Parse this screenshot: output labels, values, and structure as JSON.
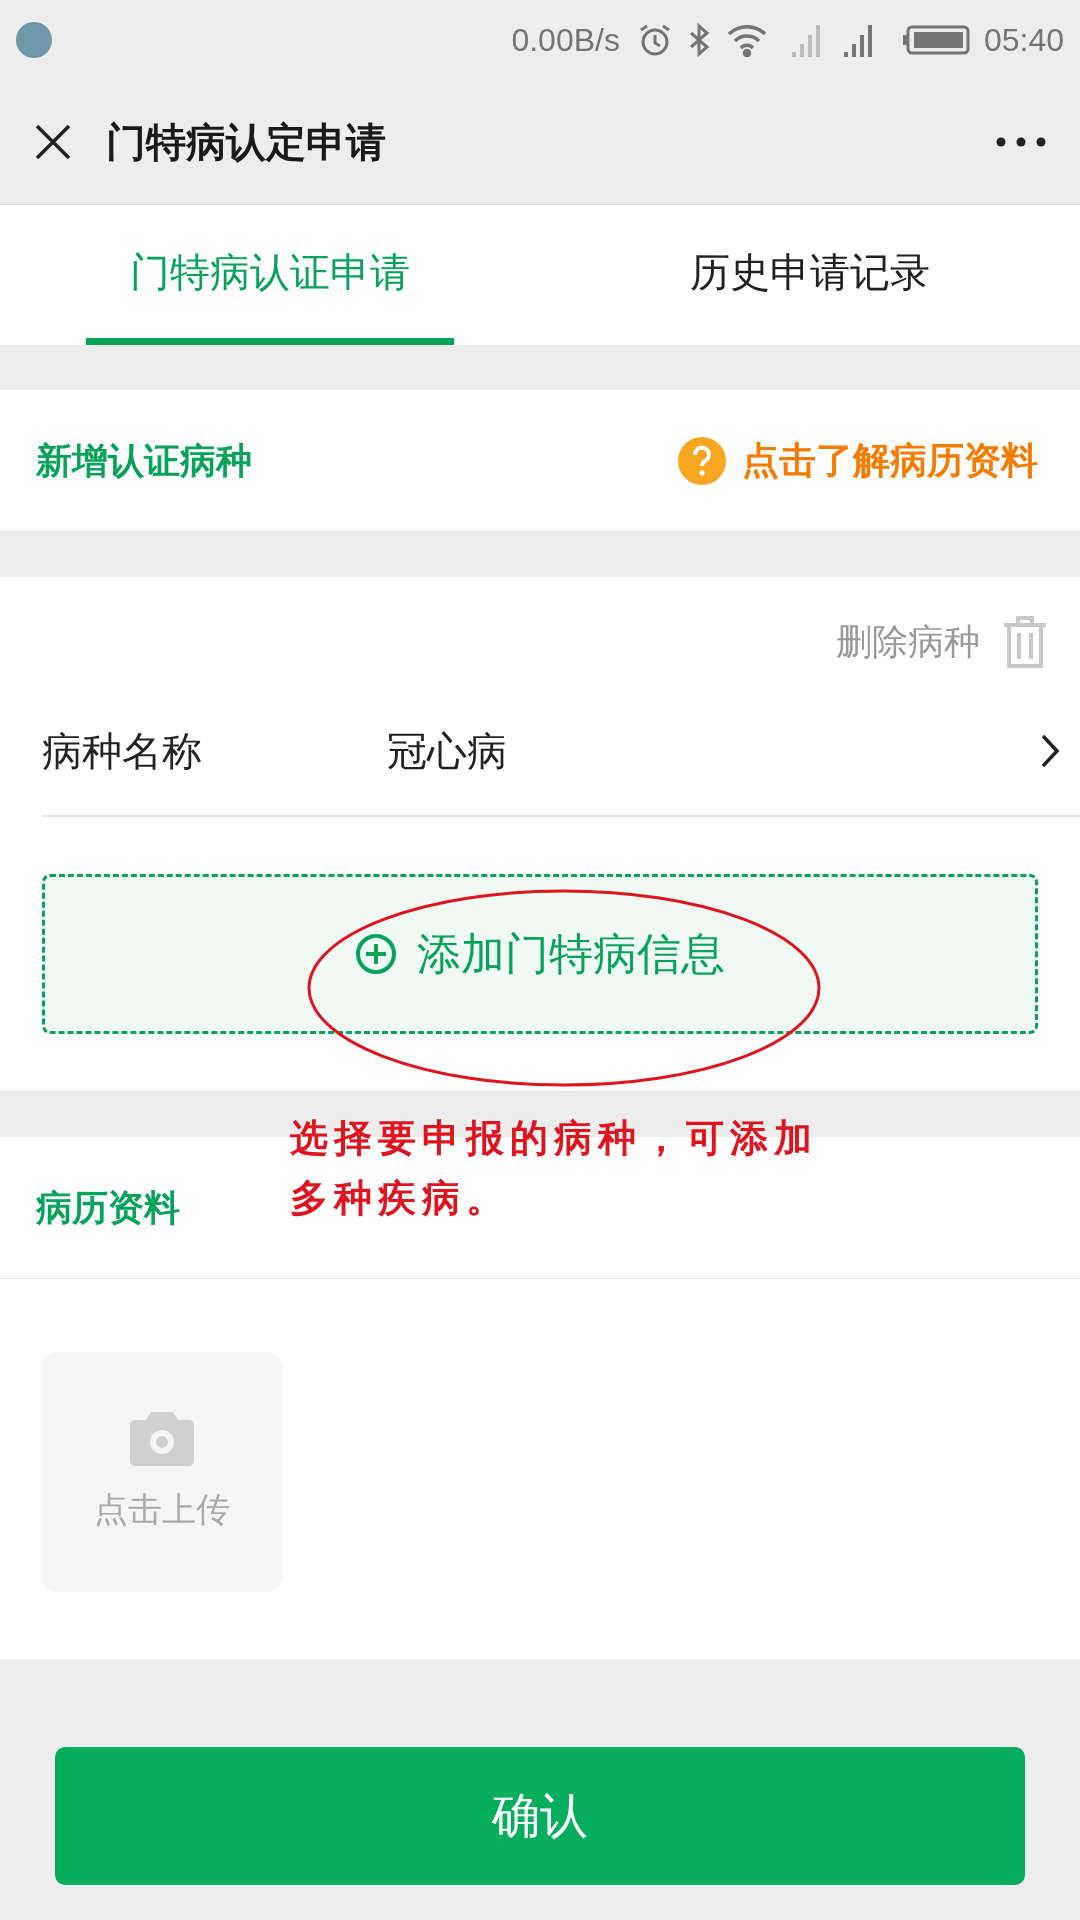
{
  "status_bar": {
    "speed": "0.00B/s",
    "time": "05:40"
  },
  "header": {
    "title": "门特病认定申请"
  },
  "tabs": [
    {
      "label": "门特病认证申请",
      "selected": true
    },
    {
      "label": "历史申请记录",
      "selected": false
    }
  ],
  "add_section": {
    "title": "新增认证病种",
    "help_link": "点击了解病历资料"
  },
  "disease_card": {
    "delete_label": "删除病种",
    "field_label": "病种名称",
    "field_value": "冠心病",
    "add_button": "添加门特病信息"
  },
  "annotation": {
    "text": "选择要申报的病种，可添加多种疾病。"
  },
  "records_section": {
    "title": "病历资料",
    "upload_label": "点击上传"
  },
  "confirm_button": "确认"
}
